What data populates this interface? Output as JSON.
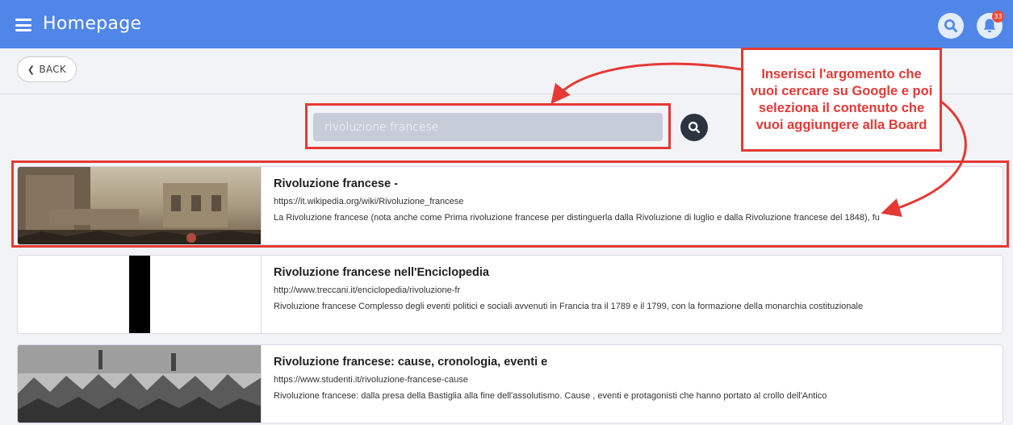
{
  "header": {
    "title": "Homepage",
    "notification_count": "33",
    "icons": [
      "menu-icon",
      "search-icon",
      "bell-icon"
    ]
  },
  "back_button": {
    "label": "BACK",
    "icon": "chevron-left-icon"
  },
  "search": {
    "value": "rivoluzione francese"
  },
  "callout": {
    "text": "Inserisci l'argomento che vuoi cercare su Google e poi seleziona il contenuto che vuoi aggiungere alla Board",
    "color": "#e53935"
  },
  "results": [
    {
      "title": "Rivoluzione francese -",
      "url": "https://it.wikipedia.org/wiki/Rivoluzione_francese",
      "description": "La Rivoluzione francese (nota anche come Prima rivoluzione francese per distinguerla dalla Rivoluzione di luglio e dalla Rivoluzione francese del 1848), fu"
    },
    {
      "title": "Rivoluzione francese nell'Enciclopedia",
      "url": "http://www.treccani.it/enciclopedia/rivoluzione-fr",
      "description": "Rivoluzione francese Complesso degli eventi politici e sociali avvenuti in Francia tra il 1789 e il 1799, con la formazione della monarchia costituzionale"
    },
    {
      "title": "Rivoluzione francese: cause, cronologia, eventi e",
      "url": "https://www.studenti.it/rivoluzione-francese-cause",
      "description": "Rivoluzione francese: dalla presa della Bastiglia alla fine dell'assolutismo. Cause , eventi e protagonisti che hanno portato al crollo dell'Antico"
    }
  ],
  "colors": {
    "header": "#4f86e8",
    "annotation": "#e53935"
  }
}
